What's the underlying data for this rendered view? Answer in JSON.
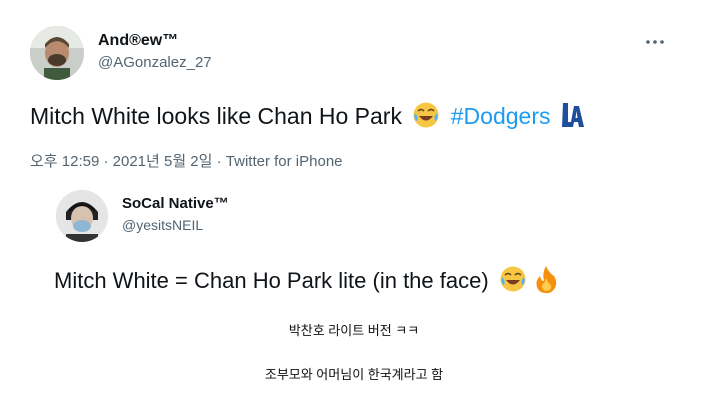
{
  "tweet": {
    "display_name": "And®ew™",
    "handle": "@AGonzalez_27",
    "text_main": "Mitch White looks like Chan Ho Park",
    "hashtag": "#Dodgers",
    "timestamp": "오후 12:59 · 2021년 5월 2일",
    "source": "Twitter for iPhone",
    "more_icon": "more-horizontal-icon"
  },
  "quoted": {
    "display_name": "SoCal Native™",
    "handle": "@yesitsNEIL",
    "text": "Mitch White = Chan Ho Park lite (in the face)"
  },
  "captions": {
    "line1": "박찬호 라이트 버전 ㅋㅋ",
    "line2": "조부모와 어머님이 한국계라고 함"
  }
}
